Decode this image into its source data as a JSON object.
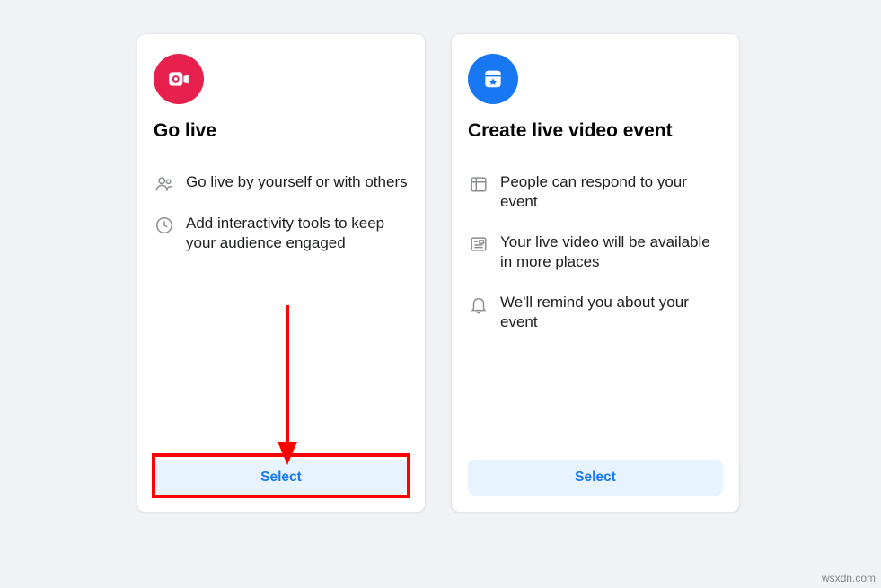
{
  "cards": {
    "go_live": {
      "title": "Go live",
      "features": [
        {
          "text": "Go live by yourself or with others"
        },
        {
          "text": "Add interactivity tools to keep your audience engaged"
        }
      ],
      "select_label": "Select"
    },
    "create_event": {
      "title": "Create live video event",
      "features": [
        {
          "text": "People can respond to your event"
        },
        {
          "text": "Your live video will be available in more places"
        },
        {
          "text": "We'll remind you about your event"
        }
      ],
      "select_label": "Select"
    }
  },
  "watermark": "wsxdn.com"
}
